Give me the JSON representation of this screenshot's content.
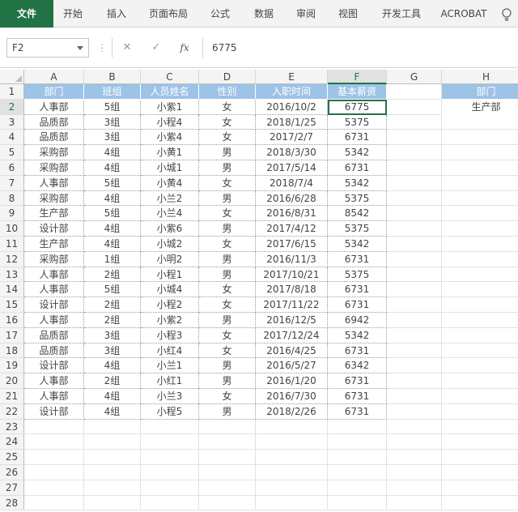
{
  "ribbon": {
    "tabs": [
      "文件",
      "开始",
      "插入",
      "页面布局",
      "公式",
      "数据",
      "审阅",
      "视图",
      "开发工具",
      "ACROBAT"
    ],
    "help_icon": "lightbulb-icon"
  },
  "formula_bar": {
    "name_box": "F2",
    "cancel_symbol": "✕",
    "enter_symbol": "✓",
    "fx_label": "fx",
    "value": "6775"
  },
  "columns": [
    "A",
    "B",
    "C",
    "D",
    "E",
    "F",
    "G",
    "H"
  ],
  "rows": [
    "1",
    "2",
    "3",
    "4",
    "5",
    "6",
    "7",
    "8",
    "9",
    "10",
    "11",
    "12",
    "13",
    "14",
    "15",
    "16",
    "17",
    "18",
    "19",
    "20",
    "21",
    "22",
    "23",
    "24",
    "25",
    "26",
    "27",
    "28"
  ],
  "table": {
    "headers": [
      "部门",
      "班组",
      "人员姓名",
      "性别",
      "入职时间",
      "基本薪资"
    ],
    "rows": [
      [
        "人事部",
        "5组",
        "小紫1",
        "女",
        "2016/10/2",
        "6775"
      ],
      [
        "品质部",
        "3组",
        "小程4",
        "女",
        "2018/1/25",
        "5375"
      ],
      [
        "品质部",
        "3组",
        "小紫4",
        "女",
        "2017/2/7",
        "6731"
      ],
      [
        "采购部",
        "4组",
        "小黄1",
        "男",
        "2018/3/30",
        "5342"
      ],
      [
        "采购部",
        "4组",
        "小城1",
        "男",
        "2017/5/14",
        "6731"
      ],
      [
        "人事部",
        "5组",
        "小黄4",
        "女",
        "2018/7/4",
        "5342"
      ],
      [
        "采购部",
        "4组",
        "小兰2",
        "男",
        "2016/6/28",
        "5375"
      ],
      [
        "生产部",
        "5组",
        "小兰4",
        "女",
        "2016/8/31",
        "8542"
      ],
      [
        "设计部",
        "4组",
        "小紫6",
        "男",
        "2017/4/12",
        "5375"
      ],
      [
        "生产部",
        "4组",
        "小城2",
        "女",
        "2017/6/15",
        "5342"
      ],
      [
        "采购部",
        "1组",
        "小明2",
        "男",
        "2016/11/3",
        "6731"
      ],
      [
        "人事部",
        "2组",
        "小程1",
        "男",
        "2017/10/21",
        "5375"
      ],
      [
        "人事部",
        "5组",
        "小城4",
        "女",
        "2017/8/18",
        "6731"
      ],
      [
        "设计部",
        "2组",
        "小程2",
        "女",
        "2017/11/22",
        "6731"
      ],
      [
        "人事部",
        "2组",
        "小紫2",
        "男",
        "2016/12/5",
        "6942"
      ],
      [
        "品质部",
        "3组",
        "小程3",
        "女",
        "2017/12/24",
        "5342"
      ],
      [
        "品质部",
        "3组",
        "小红4",
        "女",
        "2016/4/25",
        "6731"
      ],
      [
        "设计部",
        "4组",
        "小兰1",
        "男",
        "2016/5/27",
        "6342"
      ],
      [
        "人事部",
        "2组",
        "小红1",
        "男",
        "2016/1/20",
        "6731"
      ],
      [
        "人事部",
        "4组",
        "小兰3",
        "女",
        "2016/7/30",
        "6731"
      ],
      [
        "设计部",
        "4组",
        "小程5",
        "男",
        "2018/2/26",
        "6731"
      ]
    ]
  },
  "criteria": {
    "header": "部门",
    "value": "生产部"
  },
  "active_cell": "F2",
  "colors": {
    "accent": "#217346",
    "table_header_fill": "#9dc3e6"
  }
}
